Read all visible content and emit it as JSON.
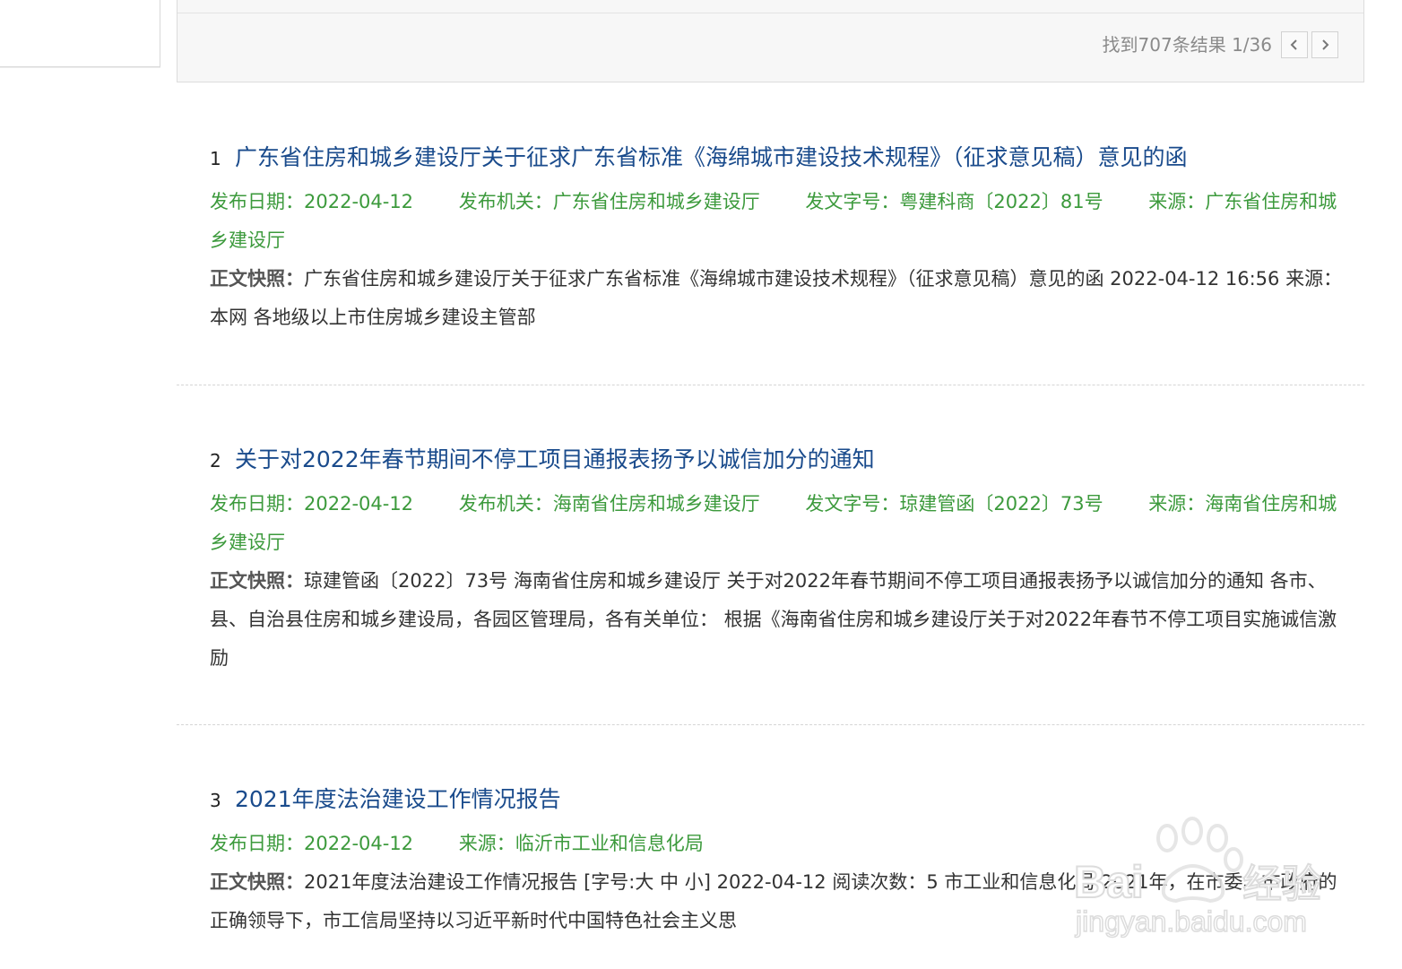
{
  "pagination": {
    "summary": "找到707条结果 1/36",
    "prev_icon": "chevron-left-icon",
    "next_icon": "chevron-right-icon"
  },
  "results": [
    {
      "index": "1",
      "title": "广东省住房和城乡建设厅关于征求广东省标准《海绵城市建设技术规程》（征求意见稿）意见的函",
      "date": "发布日期：2022-04-12",
      "agency": "发布机关：广东省住房和城乡建设厅",
      "doc_no": "发文字号：粤建科商〔2022〕81号",
      "source": "来源：广东省住房和城乡建设厅",
      "snippet_label": "正文快照：",
      "snippet": "广东省住房和城乡建设厅关于征求广东省标准《海绵城市建设技术规程》（征求意见稿）意见的函 2022-04-12 16:56 来源：本网 各地级以上市住房城乡建设主管部"
    },
    {
      "index": "2",
      "title": "关于对2022年春节期间不停工项目通报表扬予以诚信加分的通知",
      "date": "发布日期：2022-04-12",
      "agency": "发布机关：海南省住房和城乡建设厅",
      "doc_no": "发文字号：琼建管函〔2022〕73号",
      "source": "来源：海南省住房和城乡建设厅",
      "snippet_label": "正文快照：",
      "snippet": "琼建管函〔2022〕73号 海南省住房和城乡建设厅 关于对2022年春节期间不停工项目通报表扬予以诚信加分的通知 各市、县、自治县住房和城乡建设局，各园区管理局，各有关单位： 根据《海南省住房和城乡建设厅关于对2022年春节不停工项目实施诚信激励"
    },
    {
      "index": "3",
      "title": "2021年度法治建设工作情况报告",
      "date": "发布日期：2022-04-12",
      "source": "来源：临沂市工业和信息化局",
      "snippet_label": "正文快照：",
      "snippet": "2021年度法治建设工作情况报告 [字号:大 中 小] 2022-04-12 阅读次数：5 市工业和信息化局 2021年，在市委、市政府的正确领导下，市工信局坚持以习近平新时代中国特色社会主义思"
    }
  ],
  "watermark": {
    "brand": "Bai",
    "brand_cn": "经验",
    "url": "jingyan.baidu.com",
    "icon": "baidu-paw-icon"
  }
}
